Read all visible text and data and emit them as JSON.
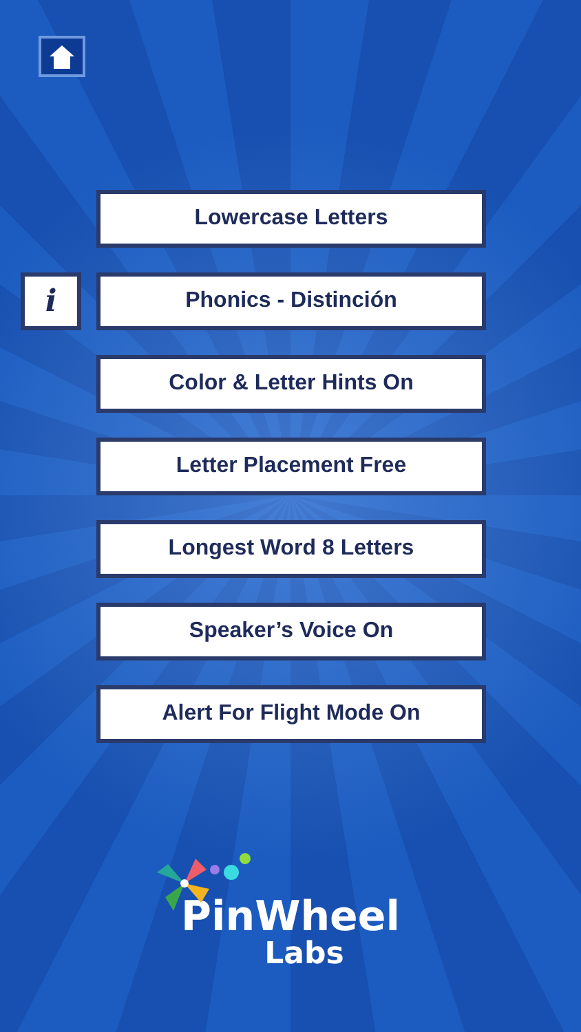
{
  "home_button": {
    "kind": "home"
  },
  "menu": [
    {
      "label": "Lowercase Letters",
      "info": false
    },
    {
      "label": "Phonics - Distinción",
      "info": true,
      "info_label": "i"
    },
    {
      "label": "Color & Letter Hints On",
      "info": false
    },
    {
      "label": "Letter Placement Free",
      "info": false
    },
    {
      "label": "Longest Word 8 Letters",
      "info": false
    },
    {
      "label": "Speaker’s Voice On",
      "info": false
    },
    {
      "label": "Alert For Flight Mode On",
      "info": false
    }
  ],
  "logo": {
    "line1": "PinWheel",
    "line2": "Labs"
  }
}
